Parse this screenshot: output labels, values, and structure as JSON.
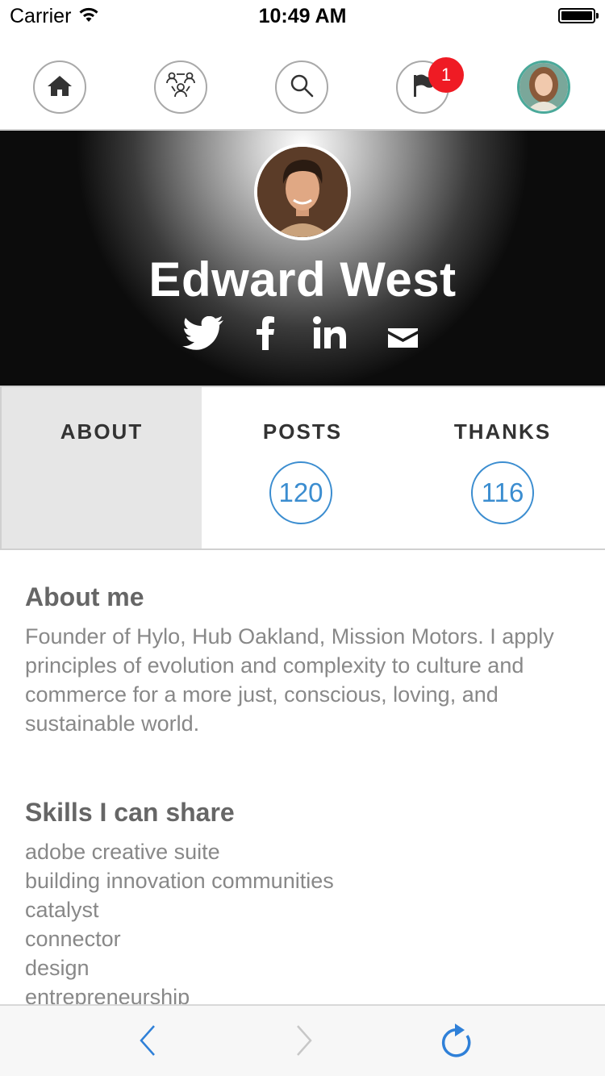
{
  "status_bar": {
    "carrier": "Carrier",
    "time": "10:49 AM"
  },
  "top_nav": {
    "items": [
      {
        "name": "home",
        "icon": "home-icon"
      },
      {
        "name": "communities",
        "icon": "community-icon"
      },
      {
        "name": "search",
        "icon": "search-icon"
      },
      {
        "name": "notifications",
        "icon": "flag-icon",
        "badge": "1"
      },
      {
        "name": "my-profile",
        "icon": "user-avatar"
      }
    ],
    "badge_color": "#ef1b24"
  },
  "profile": {
    "name": "Edward West",
    "social_icons": [
      "twitter-icon",
      "facebook-icon",
      "linkedin-icon",
      "email-icon"
    ]
  },
  "tabs": [
    {
      "label": "ABOUT",
      "active": true
    },
    {
      "label": "POSTS",
      "count": "120"
    },
    {
      "label": "THANKS",
      "count": "116"
    }
  ],
  "accent_color": "#3b8dd0",
  "about": {
    "title": "About me",
    "text": "Founder of Hylo, Hub Oakland, Mission Motors. I apply principles of evolution and complexity to culture and commerce for a more just, conscious, loving, and sustainable world."
  },
  "skills": {
    "title": "Skills I can share",
    "items": [
      "adobe creative suite",
      "building innovation communities",
      "catalyst",
      "connector",
      "design",
      "entrepreneurship"
    ]
  },
  "toolbar": {
    "icons": [
      "back-arrow-icon",
      "forward-arrow-icon",
      "refresh-icon"
    ]
  }
}
